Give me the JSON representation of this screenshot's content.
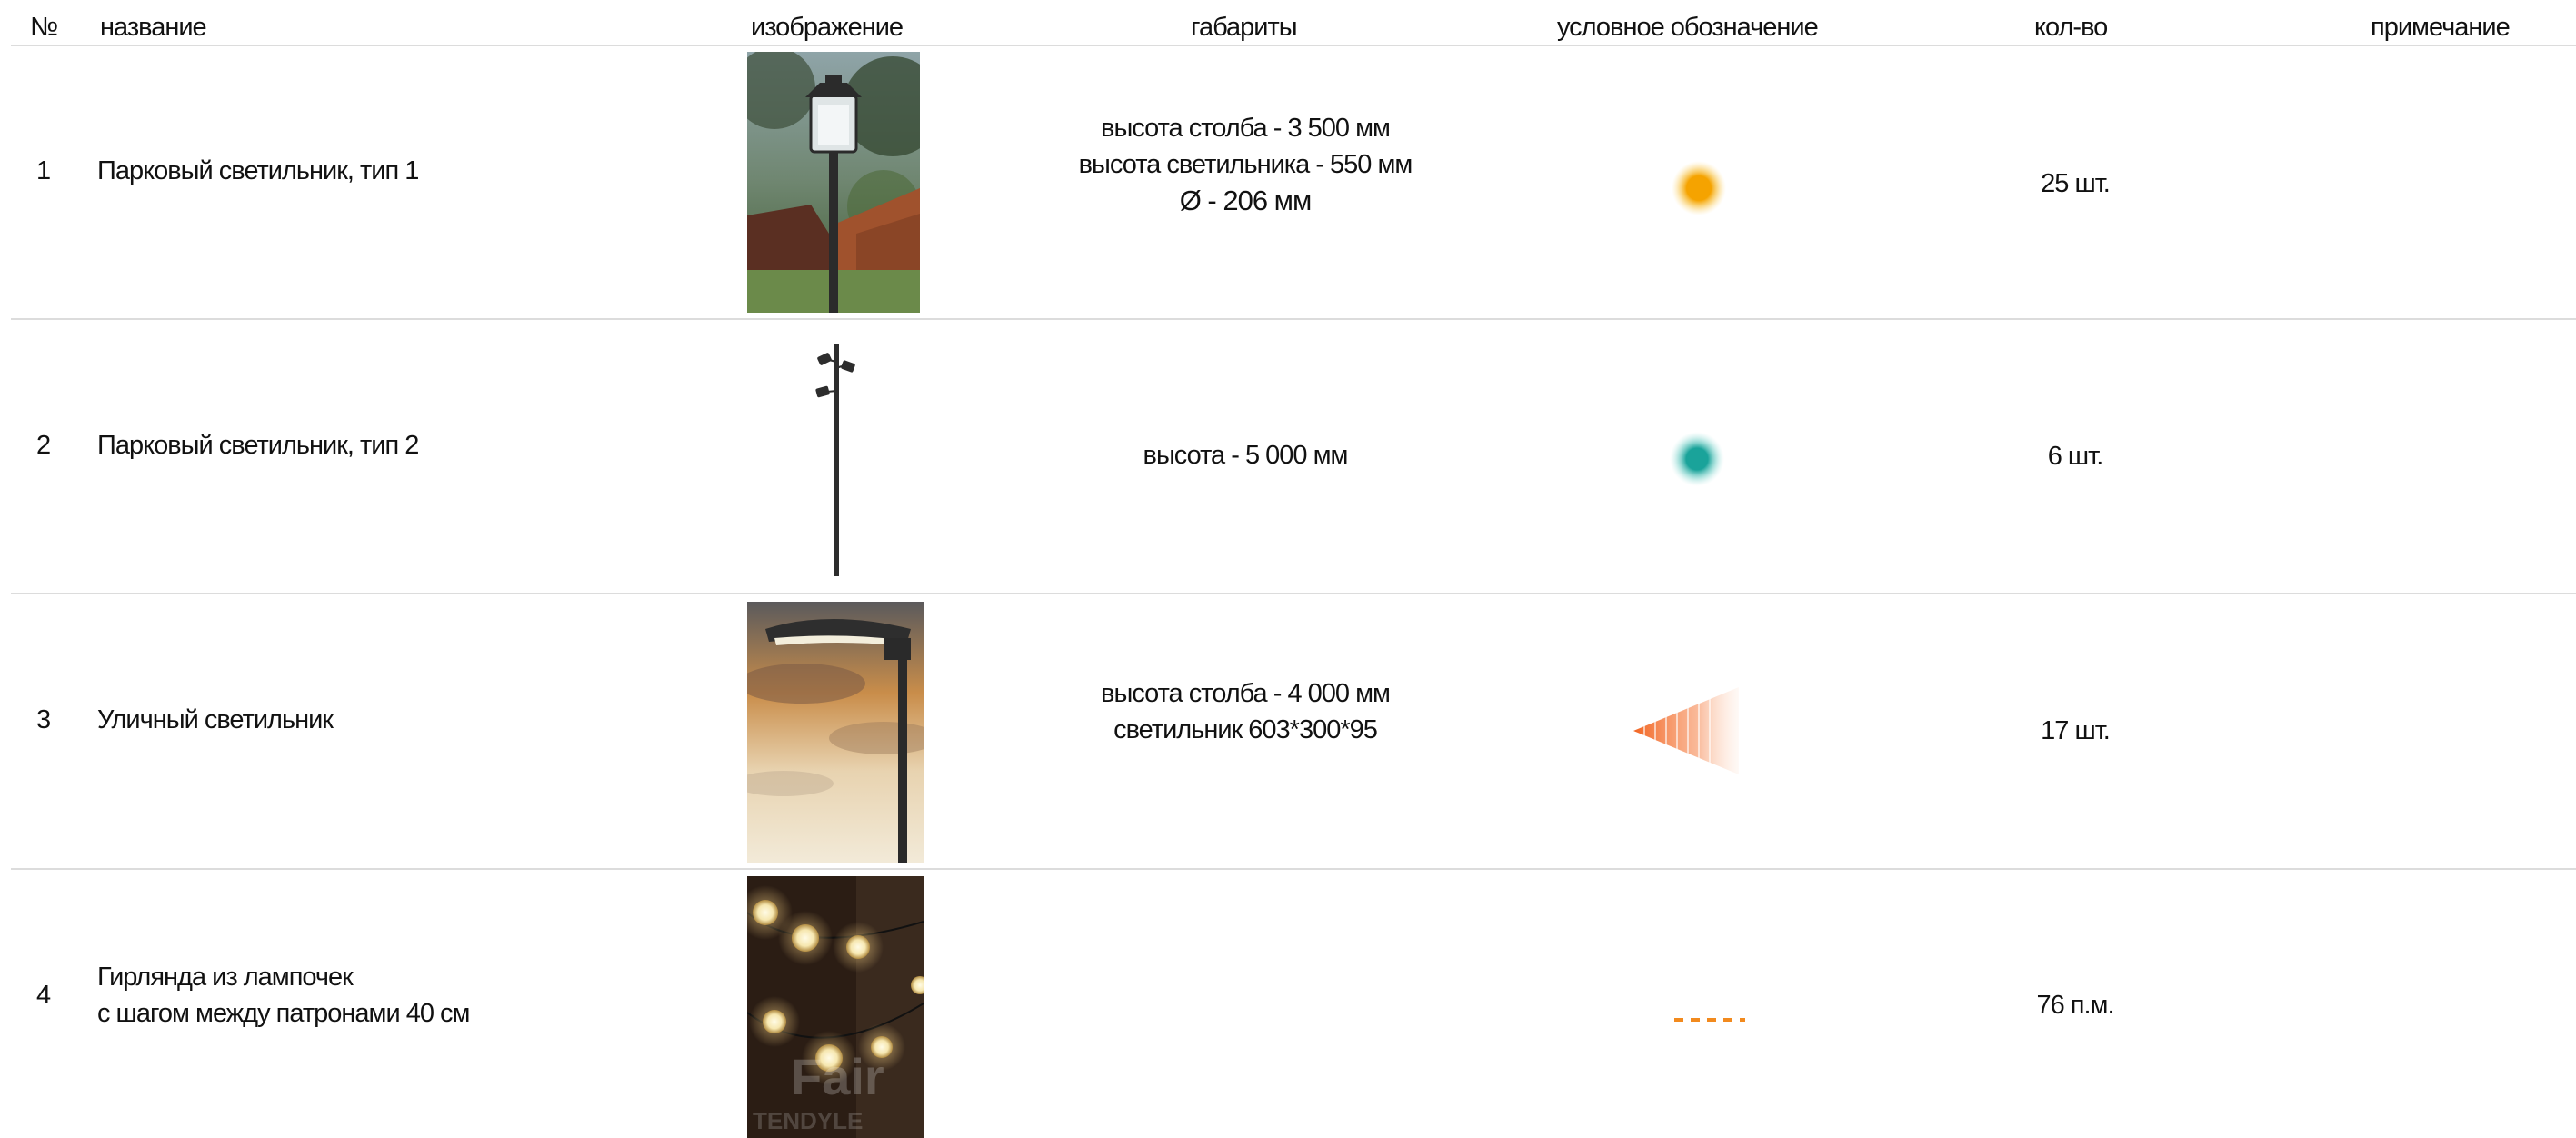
{
  "header": {
    "no": "№",
    "name": "название",
    "image": "изображение",
    "dimensions": "габариты",
    "symbol": "условное обозначение",
    "quantity": "кол-во",
    "note": "примечание"
  },
  "rows": [
    {
      "no": "1",
      "name": [
        "Парковый светильник, тип 1"
      ],
      "dims": [
        "высота столба - 3 500 мм",
        "высота светильника -  550 мм",
        "Ø - 206 мм"
      ],
      "qty": "25 шт.",
      "note": "",
      "symbol": {
        "shape": "glowing-dot",
        "color": "#f5a300"
      },
      "image_icon": "park-lamp-photo"
    },
    {
      "no": "2",
      "name": [
        "Парковый светильник, тип 2"
      ],
      "dims": [
        "высота - 5 000 мм"
      ],
      "qty": "6 шт.",
      "note": "",
      "symbol": {
        "shape": "glowing-dot",
        "color": "#1aa39a"
      },
      "image_icon": "spotlight-pole-photo"
    },
    {
      "no": "3",
      "name": [
        "Уличный светильник"
      ],
      "dims": [
        "высота столба - 4 000 мм",
        "светильник 603*300*95"
      ],
      "qty": "17 шт.",
      "note": "",
      "symbol": {
        "shape": "light-cone",
        "color": "#f26522"
      },
      "image_icon": "street-lamp-photo"
    },
    {
      "no": "4",
      "name": [
        "Гирлянда из лампочек",
        "с шагом между патронами 40 см"
      ],
      "dims": [],
      "qty": "76 п.м.",
      "note": "",
      "symbol": {
        "shape": "dashed-line",
        "color": "#f28a1e"
      },
      "image_icon": "bulb-garland-photo",
      "image_watermark": "Fair TENDYLE"
    }
  ]
}
